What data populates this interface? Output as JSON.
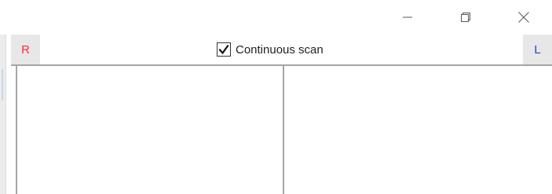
{
  "window": {
    "controls": {
      "minimize_icon": "minimize-icon",
      "restore_icon": "restore-icon",
      "close_icon": "close-icon"
    }
  },
  "toolbar": {
    "right_button_label": "R",
    "left_button_label": "L",
    "continuous_scan": {
      "label": "Continuous scan",
      "checked": true
    }
  },
  "colors": {
    "r_label": "#ff2b2b",
    "l_label": "#2f3fd0",
    "side_button_bg": "#e7e7e7",
    "divider": "#a5a5a5"
  }
}
